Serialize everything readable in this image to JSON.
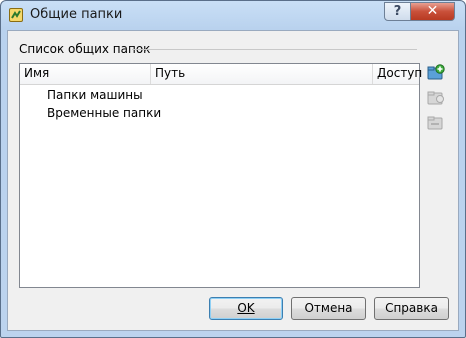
{
  "window": {
    "title": "Общие папки",
    "help_glyph": "?",
    "close_glyph": "✕"
  },
  "group": {
    "label": "Список общих папок"
  },
  "table": {
    "columns": [
      "Имя",
      "Путь",
      "Доступ"
    ],
    "rows": [
      {
        "name": "Папки машины"
      },
      {
        "name": "Временные папки"
      }
    ]
  },
  "side_buttons": [
    {
      "icon": "add-folder-icon",
      "enabled": true
    },
    {
      "icon": "edit-folder-icon",
      "enabled": false
    },
    {
      "icon": "remove-folder-icon",
      "enabled": false
    }
  ],
  "buttons": {
    "ok": "OK",
    "cancel": "Отмена",
    "help": "Справка"
  }
}
